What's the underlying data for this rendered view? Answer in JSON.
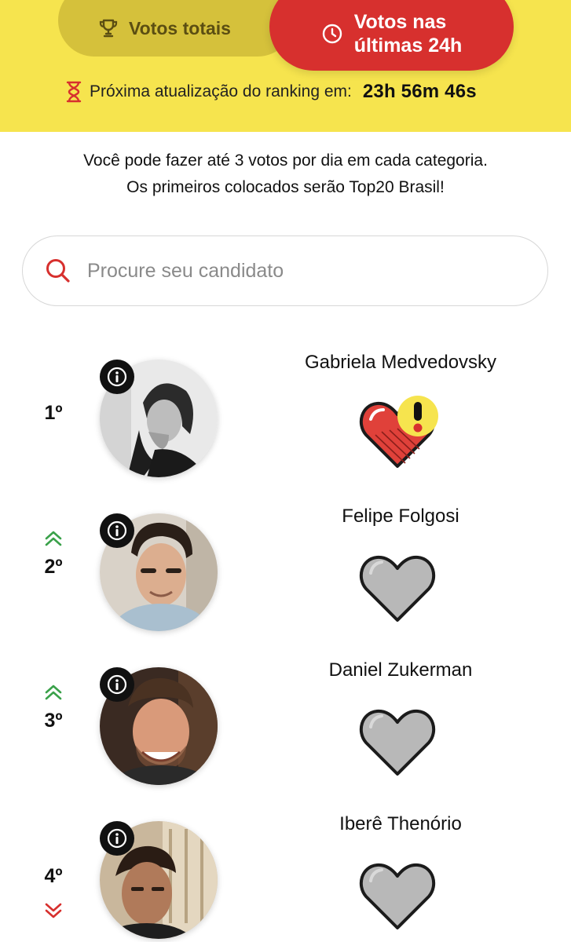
{
  "tabs": {
    "total_label": "Votos totais",
    "last24_label": "Votos nas\núltimas 24h"
  },
  "update": {
    "label": "Próxima atualização do ranking em:",
    "countdown": "23h 56m 46s"
  },
  "intro": {
    "line1": "Você pode fazer até 3 votos por dia em cada categoria.",
    "line2": "Os primeiros colocados serão Top20 Brasil!"
  },
  "search": {
    "placeholder": "Procure seu candidato"
  },
  "candidates": [
    {
      "rank": "1º",
      "name": "Gabriela Medvedovsky",
      "trend": "none",
      "vote_state": "warning"
    },
    {
      "rank": "2º",
      "name": "Felipe Folgosi",
      "trend": "up",
      "vote_state": "empty"
    },
    {
      "rank": "3º",
      "name": "Daniel Zukerman",
      "trend": "up",
      "vote_state": "empty"
    },
    {
      "rank": "4º",
      "name": "Iberê Thenório",
      "trend": "down",
      "vote_state": "empty"
    }
  ],
  "colors": {
    "header_yellow": "#f6e44e",
    "tab_total_bg": "#d5c13b",
    "tab_active_red": "#d7302e",
    "trend_up_green": "#3aa14a",
    "trend_down_red": "#d7302e",
    "heart_empty_gray": "#b8b8b8",
    "heart_voted_red": "#e0413a",
    "warning_yellow": "#f6e44e"
  },
  "icons": {
    "total_tab": "trophy-icon",
    "last24_tab": "clock-icon",
    "update": "hourglass-icon",
    "search": "search-icon",
    "info": "info-icon",
    "vote": "heart-icon",
    "warning": "exclamation-icon"
  }
}
